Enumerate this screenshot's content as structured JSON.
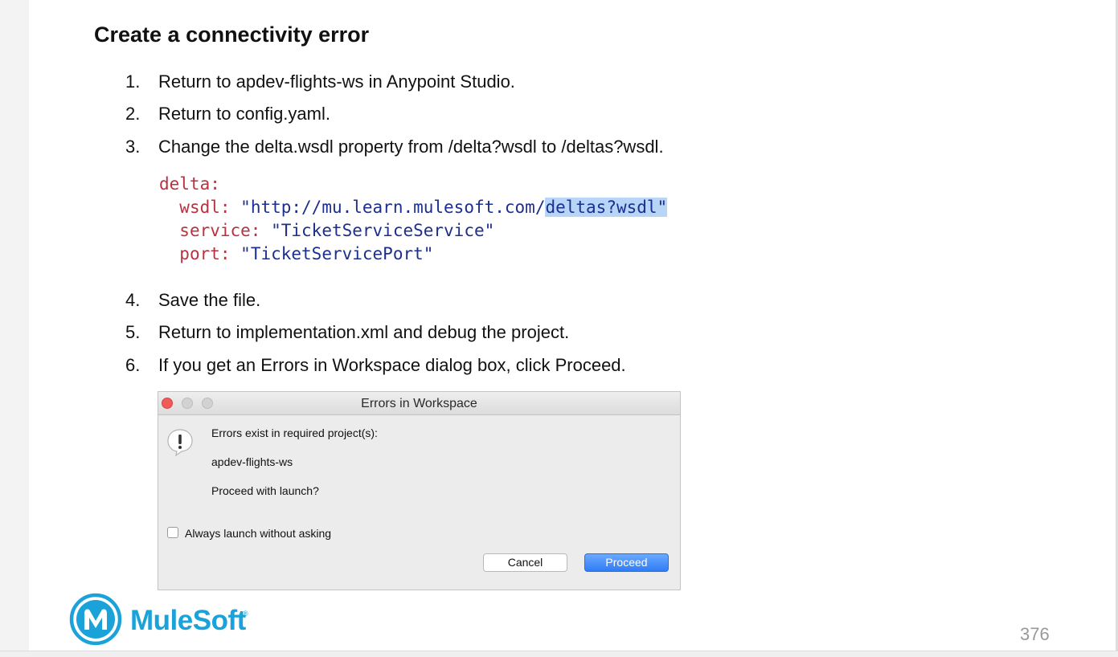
{
  "title": "Create a connectivity error",
  "steps_a": [
    {
      "num": "1.",
      "text": "Return to apdev-flights-ws in Anypoint Studio."
    },
    {
      "num": "2.",
      "text": "Return to config.yaml."
    },
    {
      "num": "3.",
      "text": "Change the delta.wsdl property from /delta?wsdl to /deltas?wsdl."
    }
  ],
  "code": {
    "l1_key": "delta:",
    "l2_key": "wsdl:",
    "l2_val_a": "\"http://mu.learn.mulesoft.com/",
    "l2_val_hl": "deltas?wsdl\"",
    "l3_key": "service:",
    "l3_val": "\"TicketServiceService\"",
    "l4_key": "port:",
    "l4_val": "\"TicketServicePort\""
  },
  "steps_b": [
    {
      "num": "4.",
      "text": "Save the file."
    },
    {
      "num": "5.",
      "text": "Return to implementation.xml and debug the project."
    },
    {
      "num": "6.",
      "text": "If you get an Errors in Workspace dialog box, click Proceed."
    }
  ],
  "dialog": {
    "title": "Errors in Workspace",
    "line1": "Errors exist in required project(s):",
    "line2": "apdev-flights-ws",
    "line3": "Proceed with launch?",
    "checkbox_label": "Always launch without asking",
    "checkbox_checked": false,
    "cancel_label": "Cancel",
    "proceed_label": "Proceed",
    "warning_icon": "warning-icon"
  },
  "logo": {
    "text": "MuleSoft",
    "tm": "®"
  },
  "page_number": "376",
  "colors": {
    "brand": "#1ba2d8",
    "code_key": "#b8323f",
    "code_string": "#1d2f8c",
    "highlight": "#b6d5f7",
    "proceed_button": "#2f7cf5"
  }
}
